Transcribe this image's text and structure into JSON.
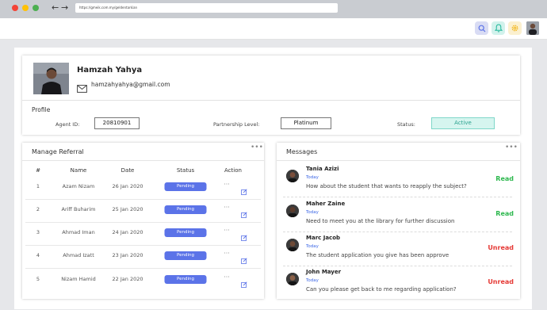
{
  "browser": {
    "url": "https://gmeik.com.my/geldentarkian"
  },
  "header": {
    "icons": [
      "search-icon",
      "bell-icon",
      "gear-icon"
    ],
    "icon_colors": {
      "search": "#d9dcf4",
      "bell": "#d2f2ec",
      "settings": "#fbf0cf"
    }
  },
  "profile": {
    "name": "Hamzah Yahya",
    "email": "hamzahyahya@gmail.com",
    "section_title": "Profile",
    "agent_id_label": "Agent ID:",
    "agent_id": "20810901",
    "partnership_label": "Partnership Level:",
    "partnership": "Platinum",
    "status_label": "Status:",
    "status": "Active"
  },
  "referral": {
    "title": "Manage Referral",
    "columns": [
      "#",
      "Name",
      "Date",
      "Status",
      "Action"
    ],
    "rows": [
      {
        "num": "1",
        "name": "Azam Nizam",
        "date": "26 Jan 2020",
        "status": "Pending"
      },
      {
        "num": "2",
        "name": "Ariff Buharim",
        "date": "25 Jan 2020",
        "status": "Pending"
      },
      {
        "num": "3",
        "name": "Ahmad Iman",
        "date": "24 Jan 2020",
        "status": "Pending"
      },
      {
        "num": "4",
        "name": "Ahmad Izatt",
        "date": "23 Jan 2020",
        "status": "Pending"
      },
      {
        "num": "5",
        "name": "Nizam Hamid",
        "date": "22 Jan 2020",
        "status": "Pending"
      }
    ],
    "more": "•••",
    "row_more": "···"
  },
  "messages": {
    "title": "Messages",
    "more": "•••",
    "items": [
      {
        "name": "Tania Azizi",
        "day": "Today",
        "text": "How about the student that wants to reapply the subject?",
        "status": "Read",
        "status_color": "#2eb84f"
      },
      {
        "name": "Maher Zaine",
        "day": "Today",
        "text": "Need to meet you at the library for further discussion",
        "status": "Read",
        "status_color": "#2eb84f"
      },
      {
        "name": "Marc Jacob",
        "day": "Today",
        "text": "The student application you give has been approve",
        "status": "Unread",
        "status_color": "#e53935"
      },
      {
        "name": "John Mayer",
        "day": "Today",
        "text": "Can you please get back to me regarding application?",
        "status": "Unread",
        "status_color": "#e53935"
      }
    ]
  },
  "colors": {
    "accent": "#5b73e8",
    "active_bg": "#d6f5ef",
    "active_text": "#2ba28f"
  }
}
